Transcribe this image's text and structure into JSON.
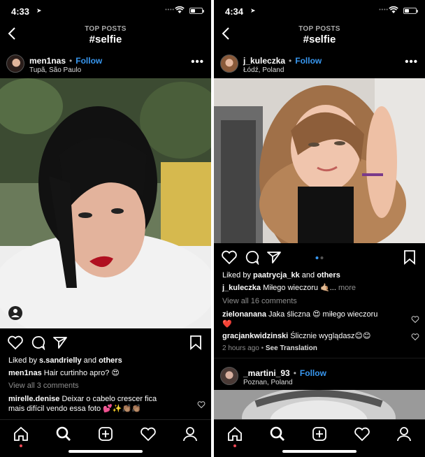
{
  "left": {
    "status": {
      "time": "4:33",
      "signal": "••••"
    },
    "nav": {
      "subtitle": "TOP POSTS",
      "title": "#selfie"
    },
    "post": {
      "username": "men1nas",
      "follow_label": "Follow",
      "location": "Tupã, São Paulo",
      "more": "•••",
      "liked_by_prefix": "Liked by",
      "liked_by_user": "s.sandrielly",
      "liked_by_and": "and",
      "liked_by_others": "others",
      "caption_user": "men1nas",
      "caption_text": "Hair curtinho apro? 😍",
      "view_comments": "View all 3 comments",
      "comments": [
        {
          "user": "mirelle.denise",
          "text": "Deixar o cabelo crescer fica",
          "text2": "mais difícil vendo essa foto 💕✨👏🏽👏🏽"
        }
      ]
    }
  },
  "right": {
    "status": {
      "time": "4:34",
      "signal": "••••"
    },
    "nav": {
      "subtitle": "TOP POSTS",
      "title": "#selfie"
    },
    "post": {
      "username": "j_kuleczka",
      "follow_label": "Follow",
      "location": "Łódź, Poland",
      "more": "•••",
      "liked_by_prefix": "Liked by",
      "liked_by_user": "paatrycja_kk",
      "liked_by_and": "and",
      "liked_by_others": "others",
      "caption_user": "j_kuleczka",
      "caption_text": "Miłego wieczoru 🤙🏼...",
      "caption_more": "more",
      "view_comments": "View all 16 comments",
      "comments": [
        {
          "user": "zielonanana",
          "text": "Jaka śliczna 😍 miłego wieczoru",
          "text2": "❤️"
        },
        {
          "user": "gracjankwidzinski",
          "text": "Ślicznie wyglądasz😊😊"
        }
      ],
      "time_ago": "2 hours ago",
      "see_translation": "See Translation"
    },
    "next_post": {
      "username": "_martini_93",
      "follow_label": "Follow",
      "location": "Poznan, Poland",
      "more": "•••"
    }
  },
  "icons": {
    "back": "chevron-left",
    "like": "heart",
    "comment": "speech-bubble",
    "share": "paper-plane",
    "save": "bookmark",
    "tabs": [
      "home",
      "search",
      "new-post",
      "activity-heart",
      "profile"
    ]
  },
  "colors": {
    "accent": "#3897f0",
    "background": "#000000",
    "notification": "#ed4956"
  }
}
